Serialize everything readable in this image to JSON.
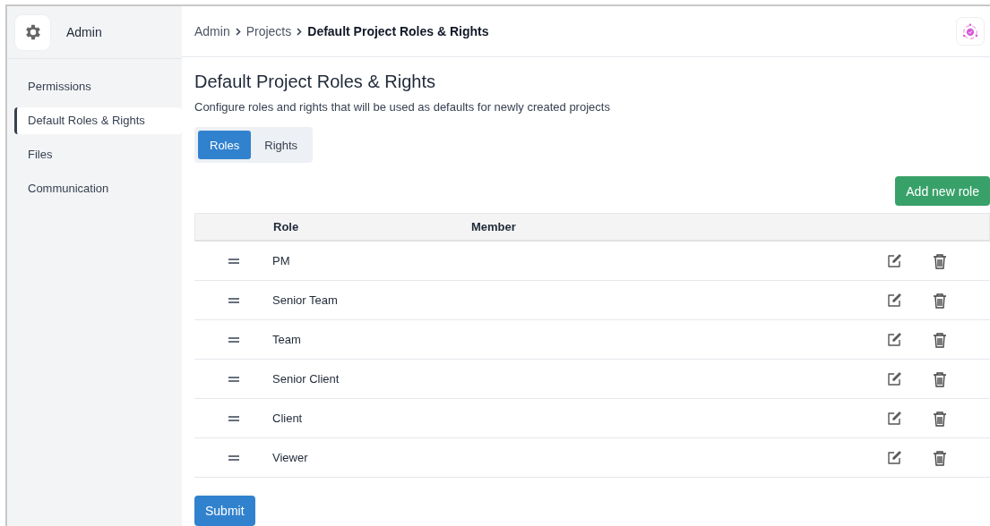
{
  "sidebar": {
    "title": "Admin",
    "items": [
      {
        "label": "Permissions",
        "selected": false
      },
      {
        "label": "Default Roles & Rights",
        "selected": true
      },
      {
        "label": "Files",
        "selected": false
      },
      {
        "label": "Communication",
        "selected": false
      }
    ]
  },
  "breadcrumb": [
    {
      "label": "Admin",
      "current": false
    },
    {
      "label": "Projects",
      "current": false
    },
    {
      "label": "Default Project Roles & Rights",
      "current": true
    }
  ],
  "page": {
    "title": "Default Project Roles & Rights",
    "subtitle": "Configure roles and rights that will be used as defaults for newly created projects"
  },
  "tabs": [
    {
      "label": "Roles",
      "selected": true
    },
    {
      "label": "Rights",
      "selected": false
    }
  ],
  "add_button": "Add new role",
  "table": {
    "columns": [
      "Role",
      "Member"
    ],
    "rows": [
      {
        "role": "PM"
      },
      {
        "role": "Senior Team"
      },
      {
        "role": "Team"
      },
      {
        "role": "Senior Client"
      },
      {
        "role": "Client"
      },
      {
        "role": "Viewer"
      }
    ]
  },
  "submit_button": "Submit"
}
